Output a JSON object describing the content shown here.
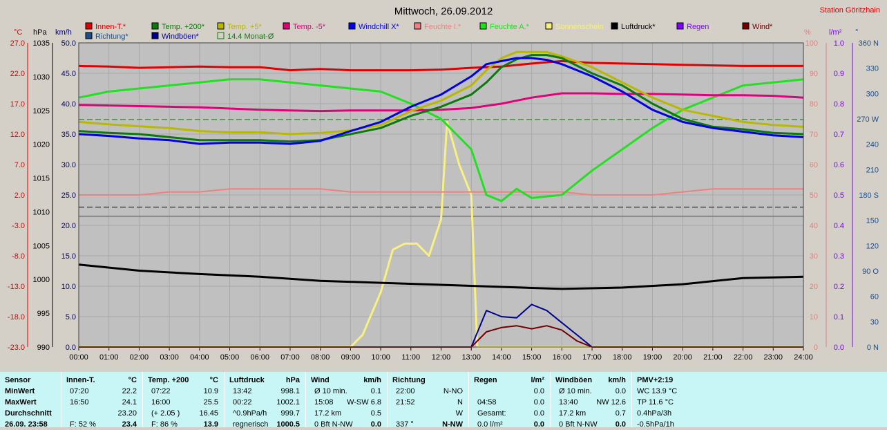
{
  "title": "Mittwoch, 26.09.2012",
  "station": "Station Göritzhain",
  "axis_headers": {
    "celsius": "°C",
    "hpa": "hPa",
    "kmh": "km/h",
    "percent": "%",
    "lm2": "l/m²",
    "degrees": "°"
  },
  "legend": [
    {
      "label": "Innen-T.*",
      "color": "#e00000"
    },
    {
      "label": "Temp. +200*",
      "color": "#0b7a0b"
    },
    {
      "label": "Temp. +5*",
      "color": "#b8b800"
    },
    {
      "label": "Temp. -5*",
      "color": "#e0007a"
    },
    {
      "label": "Windchill X*",
      "color": "#0000e0"
    },
    {
      "label": "Feuchte I.*",
      "color": "#f08080"
    },
    {
      "label": "Feuchte A.*",
      "color": "#20e020"
    },
    {
      "label": "Sonnenschein",
      "color": "#f8f080"
    },
    {
      "label": "Luftdruck*",
      "color": "#000000"
    },
    {
      "label": "Regen",
      "color": "#8000ff"
    },
    {
      "label": "Wind*",
      "color": "#700000"
    },
    {
      "label": "Richtung*",
      "color": "#1a4d8c"
    },
    {
      "label": "Windböen*",
      "color": "#000090"
    },
    {
      "label": "14.4 Monat-Ø",
      "color": "#0b7a0b"
    }
  ],
  "chart_data": {
    "type": "line",
    "x_range": [
      0,
      24
    ],
    "x_ticks": [
      "00:00",
      "01:00",
      "02:00",
      "03:00",
      "04:00",
      "05:00",
      "06:00",
      "07:00",
      "08:00",
      "09:00",
      "10:00",
      "11:00",
      "12:00",
      "13:00",
      "14:00",
      "15:00",
      "16:00",
      "17:00",
      "18:00",
      "19:00",
      "20:00",
      "21:00",
      "22:00",
      "23:00",
      "24:00"
    ],
    "axes": {
      "celsius": {
        "range": [
          -23.0,
          27.0
        ],
        "ticks": [
          "27.0",
          "22.0",
          "17.0",
          "12.0",
          "7.0",
          "2.0",
          "-3.0",
          "-8.0",
          "-13.0",
          "-18.0",
          "-23.0"
        ],
        "tick_values": [
          27,
          22,
          17,
          12,
          7,
          2,
          -3,
          -8,
          -13,
          -18,
          -23
        ],
        "color": "#e00000"
      },
      "hpa": {
        "range": [
          990,
          1035
        ],
        "ticks": [
          "1035",
          "1030",
          "1025",
          "1020",
          "1015",
          "1010",
          "1005",
          "1000",
          "995",
          "990"
        ],
        "tick_values": [
          1035,
          1030,
          1025,
          1020,
          1015,
          1010,
          1005,
          1000,
          995,
          990
        ],
        "color": "#000000"
      },
      "kmh": {
        "range": [
          0,
          50
        ],
        "ticks": [
          "50.0",
          "45.0",
          "40.0",
          "35.0",
          "30.0",
          "25.0",
          "20.0",
          "15.0",
          "10.0",
          "5.0",
          "0.0"
        ],
        "tick_values": [
          50,
          45,
          40,
          35,
          30,
          25,
          20,
          15,
          10,
          5,
          0
        ],
        "color": "#000080"
      },
      "percent": {
        "range": [
          0,
          100
        ],
        "ticks": [
          "100",
          "90",
          "80",
          "70",
          "60",
          "50",
          "40",
          "30",
          "20",
          "10",
          "0"
        ],
        "tick_values": [
          100,
          90,
          80,
          70,
          60,
          50,
          40,
          30,
          20,
          10,
          0
        ],
        "color": "#e08080"
      },
      "lm2": {
        "range": [
          0,
          1.0
        ],
        "ticks": [
          "1.0",
          "0.9",
          "0.8",
          "0.7",
          "0.6",
          "0.5",
          "0.4",
          "0.3",
          "0.2",
          "0.1",
          "0.0"
        ],
        "tick_values": [
          1.0,
          0.9,
          0.8,
          0.7,
          0.6,
          0.5,
          0.4,
          0.3,
          0.2,
          0.1,
          0.0
        ],
        "color": "#8000ff"
      },
      "direction": {
        "range": [
          0,
          360
        ],
        "ticks": [
          "360 N",
          "330",
          "300",
          "270 W",
          "240",
          "210",
          "180 S",
          "150",
          "120",
          "90 O",
          "60",
          "30",
          "0 N"
        ],
        "tick_values": [
          360,
          330,
          300,
          270,
          240,
          210,
          180,
          150,
          120,
          90,
          60,
          30,
          0
        ],
        "color": "#1a4d8c"
      }
    },
    "reference_lines": [
      {
        "name": "14.4 Monat-Ø",
        "axis": "celsius",
        "value": 14.4,
        "color": "#0b7a0b",
        "dash": true
      },
      {
        "axis": "celsius",
        "value": 0,
        "color": "#000000",
        "dash": true
      }
    ],
    "series": [
      {
        "name": "Innen-T.*",
        "axis": "celsius",
        "color": "#e00000",
        "x": [
          0,
          1,
          2,
          3,
          4,
          5,
          6,
          7,
          8,
          9,
          10,
          11,
          12,
          13,
          14,
          15,
          16,
          17,
          18,
          19,
          20,
          21,
          22,
          23,
          24
        ],
        "y": [
          23.2,
          23.1,
          22.9,
          23.0,
          23.1,
          23.0,
          23.0,
          22.5,
          22.7,
          22.5,
          22.5,
          22.5,
          22.6,
          22.9,
          23.1,
          23.6,
          24.0,
          23.7,
          23.6,
          23.5,
          23.4,
          23.3,
          23.2,
          23.2,
          23.2
        ]
      },
      {
        "name": "Temp. +200*",
        "axis": "celsius",
        "color": "#0b7a0b",
        "x": [
          0,
          1,
          2,
          3,
          4,
          5,
          6,
          7,
          8,
          9,
          10,
          11,
          12,
          13,
          13.5,
          14,
          14.5,
          15,
          15.5,
          16,
          17,
          18,
          19,
          20,
          21,
          22,
          23,
          24
        ],
        "y": [
          12.5,
          12.2,
          12.0,
          11.5,
          11.0,
          11.0,
          11.0,
          10.8,
          11.0,
          12.0,
          13.0,
          15.0,
          16.5,
          18.5,
          20.5,
          23.0,
          24.3,
          25.0,
          25.0,
          24.5,
          22.0,
          20.0,
          17.0,
          14.5,
          13.2,
          12.8,
          12.2,
          12.0
        ]
      },
      {
        "name": "Temp. +5*",
        "axis": "celsius",
        "color": "#b8b800",
        "x": [
          0,
          1,
          2,
          3,
          4,
          5,
          6,
          7,
          8,
          9,
          10,
          11,
          12,
          13,
          13.5,
          14,
          14.5,
          15,
          15.5,
          16,
          17,
          18,
          19,
          20,
          21,
          22,
          23,
          24
        ],
        "y": [
          14.0,
          13.6,
          13.3,
          13.0,
          12.5,
          12.3,
          12.3,
          12.0,
          12.2,
          12.6,
          13.5,
          15.8,
          17.5,
          20.0,
          22.5,
          24.5,
          25.5,
          25.5,
          25.5,
          24.8,
          23.0,
          20.5,
          18.0,
          16.0,
          15.0,
          14.0,
          13.5,
          13.2
        ]
      },
      {
        "name": "Temp. -5*",
        "axis": "celsius",
        "color": "#e0007a",
        "x": [
          0,
          1,
          2,
          3,
          4,
          5,
          6,
          7,
          8,
          9,
          10,
          11,
          12,
          13,
          14,
          15,
          16,
          17,
          18,
          19,
          20,
          21,
          22,
          23,
          24
        ],
        "y": [
          16.8,
          16.7,
          16.6,
          16.5,
          16.4,
          16.2,
          16.0,
          15.9,
          15.8,
          15.9,
          15.9,
          15.9,
          16.0,
          16.3,
          17.0,
          18.0,
          18.7,
          18.7,
          18.6,
          18.6,
          18.5,
          18.4,
          18.4,
          18.3,
          18.0
        ]
      },
      {
        "name": "Windchill X*",
        "axis": "celsius",
        "color": "#0000e0",
        "x": [
          0,
          1,
          2,
          3,
          4,
          5,
          6,
          7,
          8,
          9,
          10,
          11,
          12,
          13,
          13.5,
          14,
          14.5,
          15,
          15.5,
          16,
          17,
          18,
          19,
          20,
          21,
          22,
          23,
          24
        ],
        "y": [
          12.0,
          11.7,
          11.3,
          11.0,
          10.4,
          10.6,
          10.6,
          10.4,
          10.9,
          12.5,
          14.0,
          16.5,
          18.5,
          21.5,
          23.5,
          24.0,
          24.5,
          24.5,
          24.2,
          23.5,
          21.5,
          19.0,
          16.0,
          14.0,
          13.0,
          12.4,
          11.8,
          11.5
        ]
      },
      {
        "name": "Feuchte I.*",
        "axis": "percent",
        "color": "#f08080",
        "x": [
          0,
          1,
          2,
          3,
          4,
          5,
          6,
          7,
          8,
          9,
          10,
          11,
          12,
          13,
          14,
          15,
          16,
          17,
          18,
          19,
          20,
          21,
          22,
          23,
          24
        ],
        "y": [
          50,
          50,
          50,
          51,
          51,
          52,
          52,
          52,
          52,
          51,
          51,
          51,
          51,
          51,
          51,
          51,
          51,
          50,
          50,
          50,
          51,
          52,
          52,
          52,
          52
        ]
      },
      {
        "name": "Feuchte A.*",
        "axis": "percent",
        "color": "#20e020",
        "x": [
          0,
          1,
          2,
          3,
          4,
          5,
          6,
          7,
          8,
          9,
          10,
          11,
          12,
          12.5,
          13,
          13.5,
          14,
          14.5,
          15,
          16,
          17,
          18,
          19,
          20,
          21,
          22,
          23,
          24
        ],
        "y": [
          82,
          84,
          85,
          86,
          87,
          88,
          88,
          87,
          86,
          85,
          84,
          80,
          75,
          70,
          65,
          50,
          48,
          52,
          49,
          50,
          58,
          65,
          72,
          78,
          82,
          86,
          87,
          88
        ]
      },
      {
        "name": "Sonnenschein",
        "axis": "kmh",
        "color": "#f8f080",
        "x": [
          0,
          9,
          9.4,
          10,
          10.4,
          10.8,
          11.2,
          11.6,
          12,
          12.2,
          12.6,
          13,
          13.2,
          24
        ],
        "y": [
          0,
          0,
          2,
          9,
          16,
          17,
          17,
          15,
          21,
          37,
          30,
          25,
          0,
          0
        ]
      },
      {
        "name": "Luftdruck*",
        "axis": "hpa",
        "color": "#000000",
        "x": [
          0,
          2,
          4,
          6,
          8,
          10,
          12,
          14,
          16,
          18,
          20,
          22,
          24
        ],
        "y": [
          1002.2,
          1001.3,
          1000.8,
          1000.4,
          999.8,
          999.5,
          999.2,
          998.9,
          998.6,
          998.8,
          999.3,
          1000.2,
          1000.4
        ]
      },
      {
        "name": "Wind*",
        "axis": "kmh",
        "color": "#700000",
        "x": [
          0,
          13,
          13.5,
          14,
          14.5,
          15,
          15.5,
          16,
          16.5,
          17,
          24
        ],
        "y": [
          0,
          0,
          2.5,
          3.2,
          3.5,
          3.0,
          3.5,
          2.8,
          1.0,
          0,
          0
        ]
      },
      {
        "name": "Windböen*",
        "axis": "kmh",
        "color": "#000090",
        "x": [
          0,
          13,
          13.5,
          14,
          14.5,
          15,
          15.5,
          16,
          16.5,
          17,
          24
        ],
        "y": [
          0,
          0,
          6.0,
          5.0,
          4.8,
          7.0,
          6.0,
          4.0,
          2.0,
          0,
          0
        ]
      }
    ]
  },
  "table": {
    "columns": [
      {
        "header": "Sensor",
        "unit": "",
        "rows": [
          [
            "MinWert"
          ],
          [
            "MaxWert"
          ],
          [
            "Durchschnitt"
          ],
          [
            "26.09. 23:58"
          ]
        ]
      },
      {
        "header": "Innen-T.",
        "unit": "°C",
        "rows": [
          [
            "07:20",
            "22.2"
          ],
          [
            "16:50",
            "24.1"
          ],
          [
            "",
            "23.20"
          ],
          [
            "F: 52 %",
            "23.4"
          ]
        ]
      },
      {
        "header": "Temp. +200",
        "unit": "°C",
        "rows": [
          [
            "07:22",
            "10.9"
          ],
          [
            "16:00",
            "25.5"
          ],
          [
            "(+ 2.05 )",
            "16.45"
          ],
          [
            "F: 86 %",
            "13.9"
          ]
        ]
      },
      {
        "header": "Luftdruck",
        "unit": "hPa",
        "rows": [
          [
            "13:42",
            "998.1"
          ],
          [
            "00:22",
            "1002.1"
          ],
          [
            "^0.9hPa/h",
            "999.7"
          ],
          [
            "regnerisch",
            "1000.5"
          ]
        ]
      },
      {
        "header": "Wind",
        "unit": "km/h",
        "rows": [
          [
            "Ø 10 min.",
            "0.1"
          ],
          [
            "15:08",
            "W-SW 6.8"
          ],
          [
            "17.2 km",
            "0.5"
          ],
          [
            "0 Bft N-NW",
            "0.0"
          ]
        ]
      },
      {
        "header": "Richtung",
        "unit": "",
        "rows": [
          [
            "22:00",
            "N-NO"
          ],
          [
            "21:52",
            "N"
          ],
          [
            "",
            "W"
          ],
          [
            "337 °",
            "N-NW"
          ]
        ]
      },
      {
        "header": "Regen",
        "unit": "l/m²",
        "rows": [
          [
            "",
            "0.0"
          ],
          [
            "04:58",
            "0.0"
          ],
          [
            "Gesamt:",
            "0.0"
          ],
          [
            "0.0 l/m²",
            "0.0"
          ]
        ]
      },
      {
        "header": "Windböen",
        "unit": "km/h",
        "rows": [
          [
            "Ø 10 min.",
            "0.0"
          ],
          [
            "13:40",
            "NW 12.6"
          ],
          [
            "17.2 km",
            "0.7"
          ],
          [
            "0 Bft N-NW",
            "0.0"
          ]
        ]
      },
      {
        "header": "PMV+2:19",
        "unit": "",
        "rows": [
          [
            "WC 13.9 °C"
          ],
          [
            "TP 11.6 °C"
          ],
          [
            "0.4hPa/3h"
          ],
          [
            "-0.5hPa/1h"
          ]
        ]
      }
    ]
  }
}
